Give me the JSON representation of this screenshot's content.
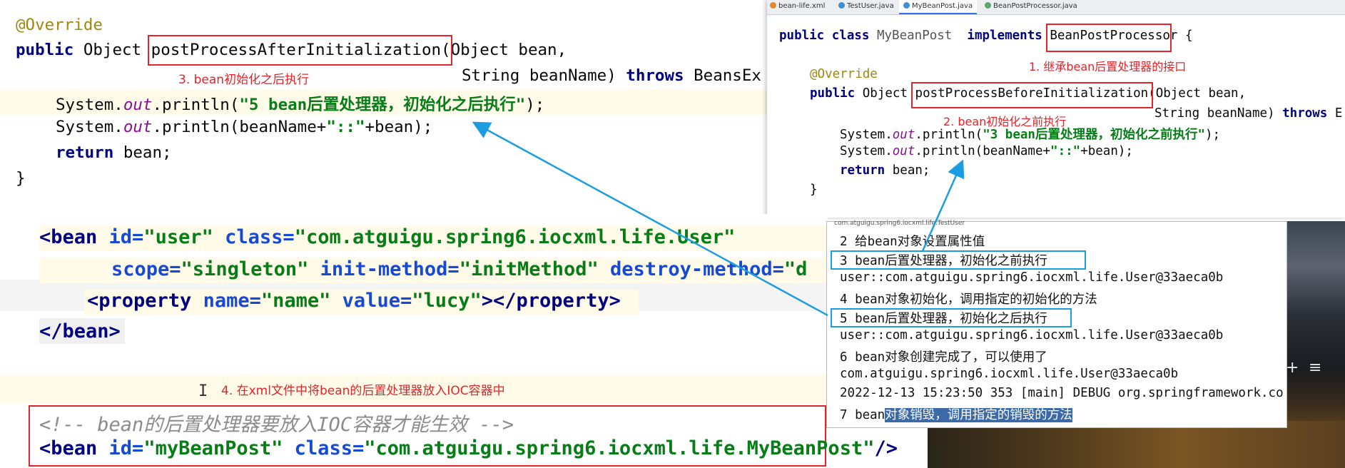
{
  "java_after": {
    "annotation": "@Override",
    "decl_kw": "public",
    "decl_type": "Object",
    "method": "postProcessAfterInitialization",
    "params1": "(Object bean,",
    "params2": "String beanName)",
    "throws_kw": "throws",
    "throws_rest": "BeansEx",
    "line1_pre": "System.",
    "line1_field": "out",
    "line1_mid": ".println(",
    "line1_str": "\"5 bean后置处理器，初始化之后执行\"",
    "line1_end": ");",
    "line2_pre": "System.",
    "line2_field": "out",
    "line2_mid": ".println(beanName+",
    "line2_str": "\"::\"",
    "line2_end": "+bean);",
    "return_kw": "return",
    "return_rest": "bean;",
    "close": "}",
    "note": "3. bean初始化之后执行"
  },
  "ide": {
    "tabs": [
      {
        "label": "bean-life.xml",
        "color": "#e08a2e"
      },
      {
        "label": "TestUser.java",
        "color": "#3d8fd6"
      },
      {
        "label": "MyBeanPost.java",
        "color": "#3d8fd6",
        "active": true
      },
      {
        "label": "BeanPostProcessor.java",
        "color": "#59a869"
      }
    ],
    "class_kw": "public class",
    "class_name": "MyBeanPost",
    "implements_kw": "implements",
    "interface_name": "BeanPostProcessor",
    "brace": "{",
    "note1": "1. 继承bean后置处理器的接口",
    "annotation": "@Override",
    "decl_kw": "public",
    "decl_type": "Object",
    "method": "postProcessBeforeInitialization",
    "params1": "(Object bean,",
    "params2": "String beanName)",
    "throws_kw": "throws",
    "throws_rest": "E",
    "note2": "2. bean初始化之前执行",
    "line1_pre": "System.",
    "line1_field": "out",
    "line1_mid": ".println(",
    "line1_str": "\"3 bean后置处理器，初始化之前执行\"",
    "line1_end": ");",
    "line2_pre": "System.",
    "line2_field": "out",
    "line2_mid": ".println(beanName+",
    "line2_str": "\"::\"",
    "line2_end": "+bean);",
    "return_kw": "return",
    "return_rest": "bean;",
    "close": "}"
  },
  "xml": {
    "l1_open": "<bean",
    "l1_id_attr": "id=",
    "l1_id_val": "\"user\"",
    "l1_class_attr": "class=",
    "l1_class_val": "\"com.atguigu.spring6.iocxml.life.User\"",
    "l2_scope_attr": "scope=",
    "l2_scope_val": "\"singleton\"",
    "l2_init_attr": "init-method=",
    "l2_init_val": "\"initMethod\"",
    "l2_destroy_attr": "destroy-method=",
    "l2_destroy_val": "\"d",
    "l3_open": "<property",
    "l3_name_attr": "name=",
    "l3_name_val": "\"name\"",
    "l3_value_attr": "value=",
    "l3_value_val": "\"lucy\"",
    "l3_close": "></property>",
    "l4": "</bean>",
    "note4": "4. 在xml文件中将bean的后置处理器放入IOC容器中",
    "comment": "<!-- bean的后置处理器要放入IOC容器才能生效 -->",
    "l6_open": "<bean",
    "l6_id_attr": "id=",
    "l6_id_val": "\"myBeanPost\"",
    "l6_class_attr": "class=",
    "l6_class_val": "\"com.atguigu.spring6.iocxml.life.MyBeanPost\"",
    "l6_close": "/>"
  },
  "console": {
    "title": "com.atguigu.spring6.iocxml.life.TestUser",
    "lines": [
      "2 给bean对象设置属性值",
      "3 bean后置处理器，初始化之前执行",
      "user::com.atguigu.spring6.iocxml.life.User@33aeca0b",
      "4 bean对象初始化，调用指定的初始化的方法",
      "5 bean后置处理器，初始化之后执行",
      "user::com.atguigu.spring6.iocxml.life.User@33aeca0b",
      "6 bean对象创建完成了，可以使用了",
      "com.atguigu.spring6.iocxml.life.User@33aeca0b",
      "2022-12-13 15:23:50 353 [main] DEBUG org.springframework.co"
    ],
    "last_plain": "7 bean",
    "last_selected": "对象销毁，调用指定的销毁的方法"
  },
  "photo_buttons": {
    "plus": "+",
    "menu": "≡"
  },
  "colors": {
    "annotation_red": "#e3252b",
    "highlight_blue": "#1c9de2",
    "arrow_blue": "#1c9de2"
  }
}
